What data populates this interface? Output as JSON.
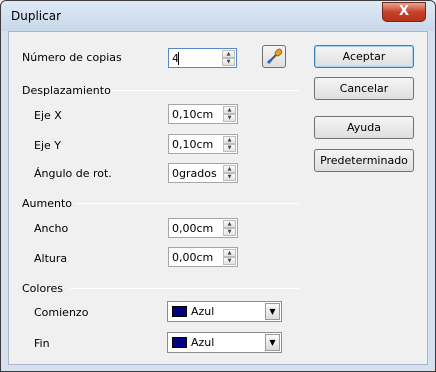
{
  "window": {
    "title": "Duplicar",
    "close_label": "X"
  },
  "copies": {
    "label": "Número de copias",
    "value": "4"
  },
  "displacement": {
    "heading": "Desplazamiento",
    "x_label": "Eje X",
    "x_value": "0,10cm",
    "y_label": "Eje Y",
    "y_value": "0,10cm",
    "angle_label": "Ángulo de rot.",
    "angle_value": "0grados"
  },
  "enlargement": {
    "heading": "Aumento",
    "width_label": "Ancho",
    "width_value": "0,00cm",
    "height_label": "Altura",
    "height_value": "0,00cm"
  },
  "colors": {
    "heading": "Colores",
    "start_label": "Comienzo",
    "start_value": "Azul",
    "start_color": "#000080",
    "end_label": "Fin",
    "end_value": "Azul",
    "end_color": "#000080"
  },
  "buttons": {
    "ok": "Aceptar",
    "cancel": "Cancelar",
    "help": "Ayuda",
    "default": "Predeterminado"
  },
  "icons": {
    "picker": "eyedropper-icon"
  }
}
